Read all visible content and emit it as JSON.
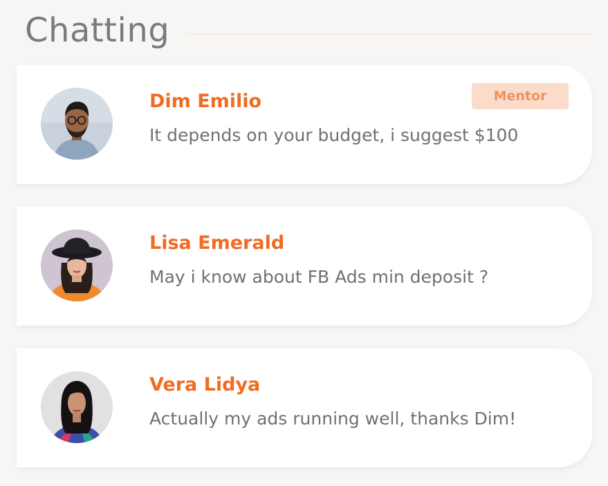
{
  "header": {
    "title": "Chatting"
  },
  "chats": [
    {
      "name": "Dim Emilio",
      "message": "It depends on your budget, i suggest $100",
      "badge": "Mentor",
      "avatar_icon": "user-avatar-man-glasses"
    },
    {
      "name": "Lisa Emerald",
      "message": "May i know about FB Ads min deposit ?",
      "avatar_icon": "user-avatar-woman-hat"
    },
    {
      "name": "Vera Lidya",
      "message": "Actually my ads running well, thanks Dim!",
      "avatar_icon": "user-avatar-woman"
    }
  ],
  "colors": {
    "accent": "#f06c24",
    "badge_bg": "#fbdccb",
    "badge_text": "#f0925c",
    "page_bg": "#f7f6f5",
    "title": "#7b7b7b",
    "message_text": "#707070"
  }
}
